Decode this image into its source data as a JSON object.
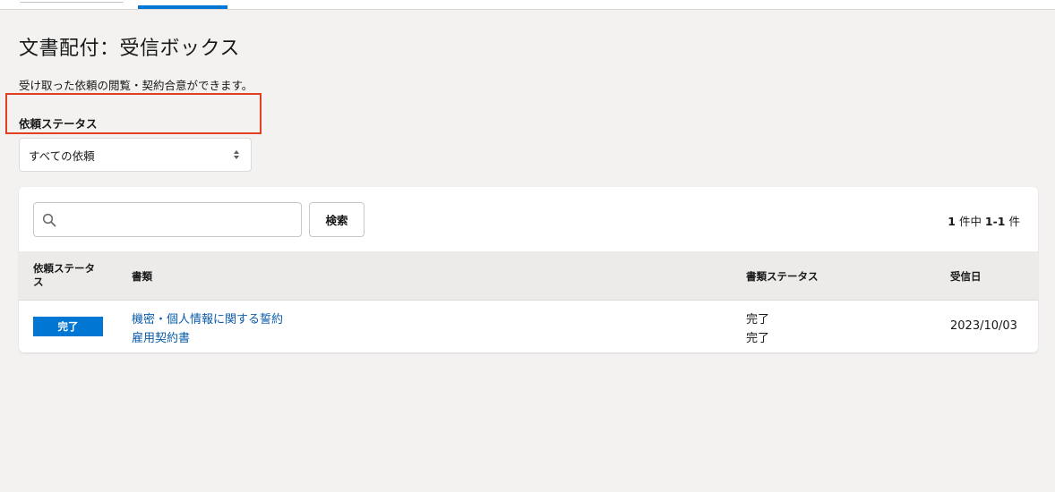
{
  "page": {
    "title": "文書配付：受信ボックス",
    "description": "受け取った依頼の閲覧・契約合意ができます。"
  },
  "filter": {
    "label": "依頼ステータス",
    "selected": "すべての依頼"
  },
  "search": {
    "placeholder": "",
    "value": "",
    "button_label": "検索",
    "icon": "search-icon"
  },
  "results": {
    "count_total": "1",
    "count_mid": " 件中 ",
    "count_range": "1-1",
    "count_suffix": " 件"
  },
  "table": {
    "headers": [
      "依頼ステータス",
      "書類",
      "書類ステータス",
      "受信日"
    ],
    "rows": [
      {
        "status": "完了",
        "documents": [
          "機密・個人情報に関する誓約",
          "雇用契約書"
        ],
        "document_statuses": [
          "完了",
          "完了"
        ],
        "received_date": "2023/10/03"
      }
    ]
  },
  "colors": {
    "accent": "#0176d3",
    "link": "#0b5cab",
    "highlight_border": "#e0401f",
    "background": "#f3f2f1"
  }
}
